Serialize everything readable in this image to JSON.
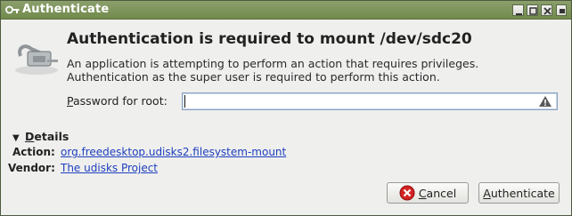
{
  "window": {
    "title": "Authenticate",
    "icon": "key-icon",
    "controls": [
      "minimize-icon",
      "maximize-icon",
      "close-icon"
    ]
  },
  "dialog": {
    "icon": "lock-keys-icon",
    "heading": "Authentication is required to mount /dev/sdc20",
    "message_line1": "An application is attempting to perform an action that requires privileges.",
    "message_line2": "Authentication as the super user is required to perform this action.",
    "password_label_mnemonic": "P",
    "password_label_rest": "assword for root:",
    "password_value": "",
    "password_warning_icon": "warning-icon"
  },
  "details": {
    "toggle_mnemonic": "D",
    "toggle_rest": "etails",
    "expanded": true,
    "action_label": "Action:",
    "action_value": "org.freedesktop.udisks2.filesystem-mount",
    "vendor_label": "Vendor:",
    "vendor_value": "The udisks Project"
  },
  "buttons": {
    "cancel_mnemonic": "C",
    "cancel_rest": "ancel",
    "cancel_icon": "cancel-icon",
    "authenticate_mnemonic": "A",
    "authenticate_rest": "uthenticate"
  }
}
